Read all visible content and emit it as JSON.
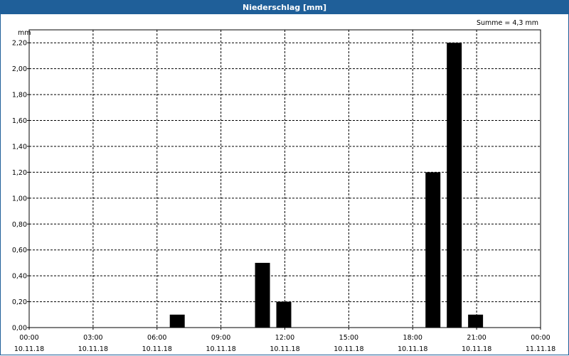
{
  "window": {
    "title": "Niederschlag [mm]"
  },
  "chart_data": {
    "type": "bar",
    "title": "Niederschlag [mm]",
    "ylabel": "mm",
    "summary": "Summe = 4,3 mm",
    "ylim": [
      0,
      2.3
    ],
    "yticks": [
      0,
      0.2,
      0.4,
      0.6,
      0.8,
      1.0,
      1.2,
      1.4,
      1.6,
      1.8,
      2.0,
      2.2
    ],
    "ytick_labels": [
      "0,00",
      "0,20",
      "0,40",
      "0,60",
      "0,80",
      "1,00",
      "1,20",
      "1,40",
      "1,60",
      "1,80",
      "2,00",
      "2,20"
    ],
    "xlim_hours": [
      0,
      24
    ],
    "xticks": [
      {
        "hour": 0,
        "time": "00:00",
        "date": "10.11.18"
      },
      {
        "hour": 3,
        "time": "03:00",
        "date": "10.11.18"
      },
      {
        "hour": 6,
        "time": "06:00",
        "date": "10.11.18"
      },
      {
        "hour": 9,
        "time": "09:00",
        "date": "10.11.18"
      },
      {
        "hour": 12,
        "time": "12:00",
        "date": "10.11.18"
      },
      {
        "hour": 15,
        "time": "15:00",
        "date": "10.11.18"
      },
      {
        "hour": 18,
        "time": "18:00",
        "date": "10.11.18"
      },
      {
        "hour": 21,
        "time": "21:00",
        "date": "10.11.18"
      },
      {
        "hour": 24,
        "time": "00:00",
        "date": "11.11.18"
      }
    ],
    "bars": [
      {
        "hour": 7,
        "value": 0.1
      },
      {
        "hour": 11,
        "value": 0.5
      },
      {
        "hour": 12,
        "value": 0.2
      },
      {
        "hour": 19,
        "value": 1.2
      },
      {
        "hour": 20,
        "value": 2.2
      },
      {
        "hour": 21,
        "value": 0.1
      }
    ],
    "grid": true,
    "bar_color": "#000000",
    "header_color": "#1f5f99"
  }
}
